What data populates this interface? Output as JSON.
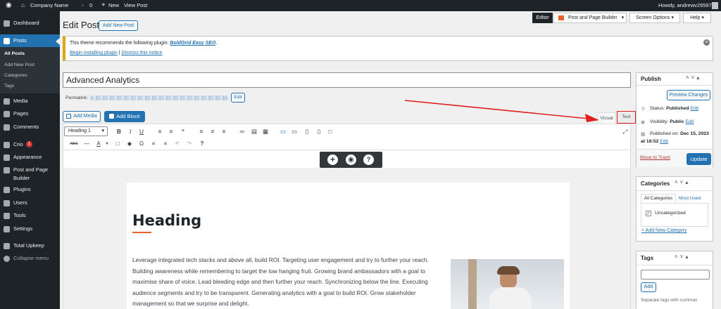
{
  "adminbar": {
    "site_name": "Company Name",
    "comments_count": "0",
    "new_label": "New",
    "view_post": "View Post",
    "howdy": "Howdy, andrewv29597"
  },
  "sidebar": {
    "items": [
      {
        "label": "Dashboard"
      },
      {
        "label": "Posts"
      },
      {
        "label": "Media"
      },
      {
        "label": "Pages"
      },
      {
        "label": "Comments"
      },
      {
        "label": "Crio",
        "badge": "1"
      },
      {
        "label": "Appearance"
      },
      {
        "label": "Post and Page Builder"
      },
      {
        "label": "Plugins"
      },
      {
        "label": "Users"
      },
      {
        "label": "Tools"
      },
      {
        "label": "Settings"
      },
      {
        "label": "Total Upkeep"
      },
      {
        "label": "Collapse menu"
      }
    ],
    "posts_sub": [
      "All Posts",
      "Add New Post",
      "Categories",
      "Tags"
    ]
  },
  "topright": {
    "editor": "Editor",
    "post_page_builder": "Post and Page Builder",
    "screen_options": "Screen Options",
    "help": "Help"
  },
  "header": {
    "title": "Edit Post",
    "add_new": "Add New Post"
  },
  "notice": {
    "text_prefix": "This theme recommends the following plugin:",
    "plugin": "BoldGrid Easy SEO",
    "text_suffix": ".",
    "begin": "Begin installing plugin",
    "separator": "|",
    "dismiss": "Dismiss this notice"
  },
  "editor": {
    "post_title": "Advanced Analytics",
    "permalink_label": "Permalink:",
    "edit": "Edit",
    "add_media": "Add Media",
    "add_block": "Add Block",
    "tab_visual": "Visual",
    "tab_text": "Text",
    "format_select": "Heading 1",
    "heading": "Heading",
    "paragraph": "Leverage integrated tech stacks and above all, build ROI. Targeting user engagement and try to further your reach. Building awareness while remembering to target the low hanging fruit. Growing brand ambassadors with a goal to maximise share of voice. Lead bleeding edge and then further your reach. Synchronizing below the line. Executing audience segments and try to be transparent. Generating analytics with a goal to build ROI. Grow stakeholder management so that we surprise and delight."
  },
  "publish": {
    "title": "Publish",
    "preview": "Preview Changes",
    "status_label": "Status:",
    "status_value": "Published",
    "edit": "Edit",
    "visibility_label": "Visibility:",
    "visibility_value": "Public",
    "published_label": "Published on:",
    "published_value": "Dec 15, 2023",
    "published_time": "at 18:52",
    "trash": "Move to Trash",
    "update": "Update"
  },
  "categories": {
    "title": "Categories",
    "tab_all": "All Categories",
    "tab_used": "Most Used",
    "item": "Uncategorized",
    "add_new": "+ Add New Category"
  },
  "tags": {
    "title": "Tags",
    "add": "Add",
    "hint": "Separate tags with commas"
  },
  "colors": {
    "admin_dark": "#1d2327",
    "accent": "#2271b1",
    "notice_border": "#dba617",
    "annotation": "#e02020",
    "heading_underline": "#e8622c"
  }
}
